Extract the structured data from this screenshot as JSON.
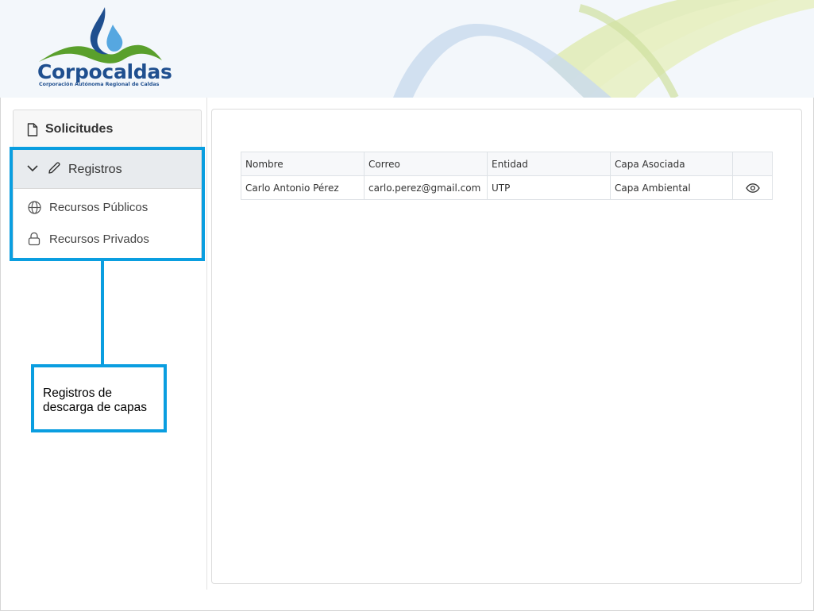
{
  "brand": {
    "name": "Corpocaldas",
    "subtitle": "Corporación Autónoma Regional de Caldas",
    "colors": {
      "blue": "#1f4f8f",
      "green": "#5aa02c",
      "wave_green": "#c9e07a",
      "wave_blue": "#a9c6e6"
    }
  },
  "sidebar": {
    "solicitudes": {
      "label": "Solicitudes",
      "icon": "document-icon"
    },
    "registros": {
      "label": "Registros",
      "icon": "pencil-icon",
      "expanded": true,
      "items": [
        {
          "label": "Recursos Públicos",
          "icon": "globe-icon"
        },
        {
          "label": "Recursos Privados",
          "icon": "lock-icon"
        }
      ]
    }
  },
  "annotation": {
    "text": "Registros de descarga de capas",
    "color": "#0a9ee0"
  },
  "table": {
    "headers": [
      "Nombre",
      "Correo",
      "Entidad",
      "Capa Asociada",
      ""
    ],
    "rows": [
      {
        "nombre": "Carlo Antonio Pérez",
        "correo": "carlo.perez@gmail.com",
        "entidad": "UTP",
        "capa": "Capa Ambiental",
        "action_icon": "eye-icon"
      }
    ]
  }
}
